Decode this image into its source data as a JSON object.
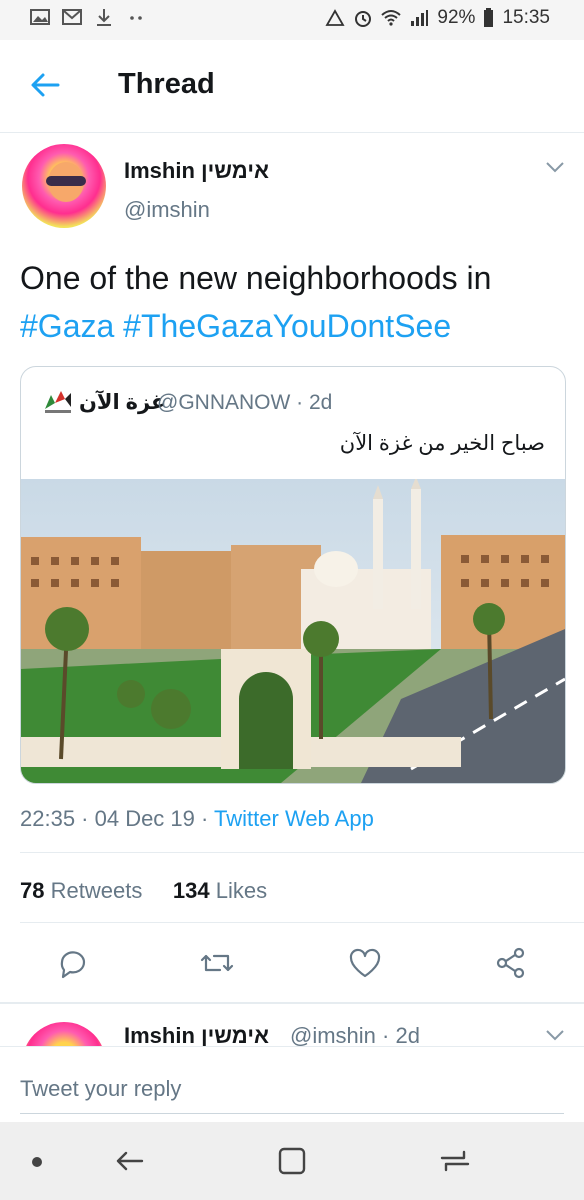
{
  "status_bar": {
    "battery": "92%",
    "time": "15:35",
    "left_icons": [
      "image-icon",
      "gmail-icon",
      "download-icon",
      "more-dots-icon"
    ],
    "right_icons": [
      "sync-icon",
      "alarm-icon",
      "wifi-icon",
      "signal-icon",
      "battery-icon"
    ]
  },
  "header": {
    "title": "Thread",
    "back_icon": "arrow-left-icon"
  },
  "tweet": {
    "author_name": "Imshin אימשין",
    "author_handle": "@imshin",
    "text_plain": "One of the new neighborhoods in",
    "hashtag_1": "#Gaza",
    "hashtag_2": "#TheGazaYouDontSee",
    "quote": {
      "author_name": "غزة الآن",
      "handle_and_time": "@GNNANOW · 2d",
      "text": "صباح الخير من غزة الآن"
    },
    "time": "22:35 · 04 Dec 19 · ",
    "source": "Twitter Web App",
    "retweets_count": "78",
    "retweets_label": "Retweets",
    "likes_count": "134",
    "likes_label": "Likes"
  },
  "next_tweet": {
    "author_name": "Imshin אימשין",
    "handle_and_time": "@imshin · 2d"
  },
  "reply": {
    "placeholder": "Tweet your reply"
  },
  "colors": {
    "accent": "#1da1f2",
    "secondary_text": "#657786",
    "border": "#e6ecf0"
  }
}
